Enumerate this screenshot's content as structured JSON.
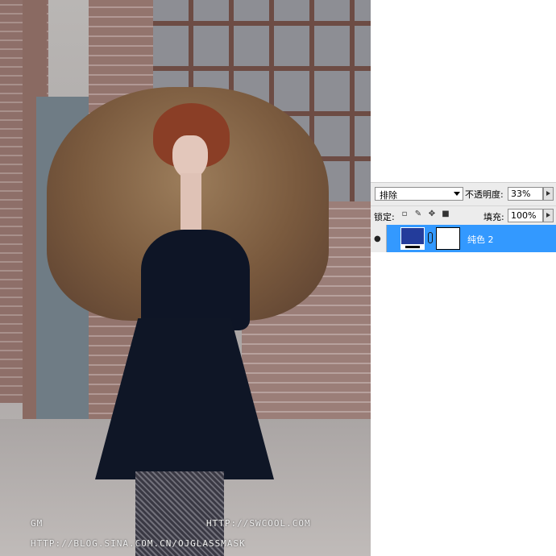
{
  "photo": {
    "watermarks": {
      "author": "GM",
      "url1": "HTTP://SWCOOL.COM",
      "url2": "HTTP://BLOG.SINA.COM.CN/OJGLASSMASK"
    }
  },
  "layers_panel": {
    "blend_mode": "排除",
    "opacity_label": "不透明度:",
    "opacity_value": "33%",
    "lock_label": "锁定:",
    "lock_icons": [
      "lock-transparent-icon",
      "lock-brush-icon",
      "lock-move-icon",
      "lock-all-icon"
    ],
    "fill_label": "填充:",
    "fill_value": "100%",
    "layer": {
      "name": "纯色 2",
      "fill_color": "#233c9b",
      "selected_color": "#3399ff",
      "visible": true
    }
  }
}
